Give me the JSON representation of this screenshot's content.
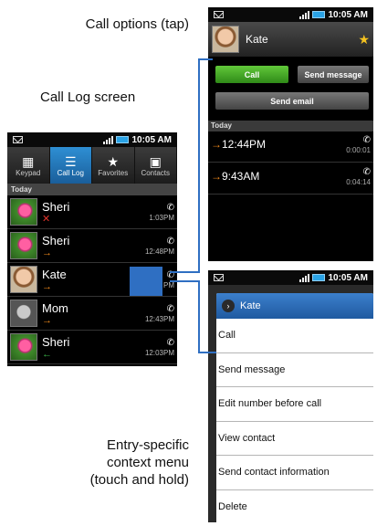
{
  "captions": {
    "call_options": "Call options (tap)",
    "call_log": "Call Log screen",
    "context_line1": "Entry-specific",
    "context_line2": "context menu",
    "context_line3": "(touch and hold)"
  },
  "status_time": "10:05 AM",
  "call_log": {
    "tabs": [
      {
        "label": "Keypad",
        "icon": "keypad-icon"
      },
      {
        "label": "Call Log",
        "icon": "call-log-icon"
      },
      {
        "label": "Favorites",
        "icon": "star-icon"
      },
      {
        "label": "Contacts",
        "icon": "contacts-icon"
      }
    ],
    "section": "Today",
    "entries": [
      {
        "name": "Sheri",
        "time": "1:03PM",
        "type": "missed",
        "arrow": "✕"
      },
      {
        "name": "Sheri",
        "time": "12:48PM",
        "type": "outgoing",
        "arrow": "→"
      },
      {
        "name": "Kate",
        "time": "PM",
        "type": "outgoing",
        "arrow": "→"
      },
      {
        "name": "Mom",
        "time": "12:43PM",
        "type": "outgoing",
        "arrow": "→"
      },
      {
        "name": "Sheri",
        "time": "12:03PM",
        "type": "incoming",
        "arrow": "←"
      }
    ]
  },
  "call_options": {
    "contact_name": "Kate",
    "call_button": "Call",
    "send_message_button": "Send message",
    "send_email_button": "Send email",
    "section": "Today",
    "calls": [
      {
        "time": "12:44PM",
        "duration": "0:00:01"
      },
      {
        "time": "9:43AM",
        "duration": "0:04:14"
      }
    ]
  },
  "context_menu": {
    "title": "Kate",
    "items": [
      "Call",
      "Send message",
      "Edit number before call",
      "View contact",
      "Send contact information",
      "Delete"
    ]
  },
  "colors": {
    "accent_blue": "#2f6fc2",
    "call_green": "#3f9a22",
    "outgoing_orange": "#f08a1c",
    "missed_red": "#e0342c",
    "incoming_green": "#3ab54a",
    "favorite_yellow": "#f5c320"
  }
}
